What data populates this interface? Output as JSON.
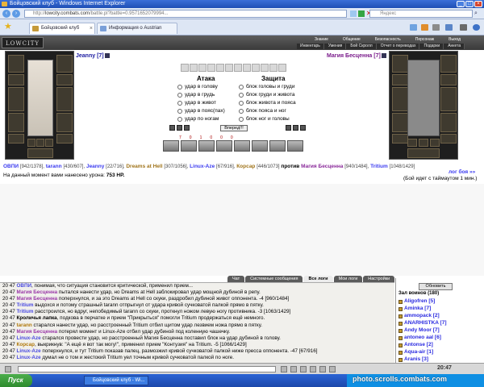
{
  "browser": {
    "title": "Бойцовский клуб - Windows Internet Explorer",
    "url_prefix": "http://",
    "url_domain": "lowcity.combats.com",
    "url_rest": "/battle.pl?battle=0.9571652079994...",
    "search_placeholder": "Яндекс",
    "tabs": [
      {
        "label": "Бойцовский клуб"
      },
      {
        "label": "Информация о Austrian"
      }
    ]
  },
  "game": {
    "logo": "LOWCITY",
    "menu_top": [
      "Знание",
      "Общение",
      "Безопасность",
      "Персонаж",
      "Выход"
    ],
    "menu_bottom": [
      "Инвентарь",
      "Умения",
      "Бой Скролл",
      "Отчет о переводах",
      "Подарки",
      "Анкета"
    ]
  },
  "combat": {
    "player_left": "Jeanny [7]",
    "player_right": "Магия Бесценна [7]",
    "attack_title": "Атака",
    "defense_title": "Защита",
    "attacks": [
      "удар в голову",
      "удар в грудь",
      "удар в живот",
      "удар в пояс(пах)",
      "удар по ногам"
    ],
    "defenses": [
      "блок головы и груди",
      "блок груди и живота",
      "блок живота и пояса",
      "блок пояса и ног",
      "блок ног и головы"
    ],
    "go_button": "Вперед!!!",
    "counters": [
      "7",
      "0",
      "1",
      "0",
      "0",
      "0"
    ]
  },
  "fighters": {
    "ally1": "ОВПИ",
    "ally1_hp": "[942/1378],",
    "ally2": "tarann",
    "ally2_hp": "[430/607],",
    "ally3": "Jeanny",
    "ally3_hp": "[22/716],",
    "ally4": "Dreams at Hell",
    "ally4_hp": "[307/1056],",
    "ally5": "Linux-Aze",
    "ally5_hp": "[67/916],",
    "ally6": "Корсар",
    "ally6_hp": "[446/1073]",
    "vs": "против",
    "enemy1": "Магия Бесценна",
    "enemy1_hp": "[940/1484],",
    "enemy2": "Tritium",
    "enemy2_hp": "[1048/1429]",
    "enemy3": "лог боя »»",
    "damage_label": "На данный момент вами нанесено урона:",
    "damage_value": "753 HP.",
    "timeout": "(Бой идет с таймаутом 1 мин.)"
  },
  "log_tabs": [
    "Чат",
    "Системные сообщения",
    "Все логи",
    "Мои логи",
    "Настройки"
  ],
  "log": [
    [
      "20 47",
      "ОВПИ",
      ", понимая, что ситуация становится критической, применил прием..."
    ],
    [
      "20 47",
      "Магия Бесценна",
      " пытался нанести удар, но Dreams at Hell заблокировал удар мощной дубиной в репу."
    ],
    [
      "20 47",
      "Магия Бесценна",
      " поперхнулся, и за это Dreams at Hell со скуки, раздробил дубиной живот оппонента. -4 [960/1484]"
    ],
    [
      "20 47",
      "Tritium",
      " выдохся и потому страшный tarann отпрыгнул от удара кривой сучковатой палкой прямо в пятку."
    ],
    [
      "20 47",
      "Tritium",
      " расстроился, но вдруг, непобедимый tarann со скуки, проткнул ножом левую ногу противника. -3 [1063/1429]"
    ],
    [
      "20 47",
      "Кроличья лапка",
      ", подкова в перчатке и прием \"Прикрыться\" помогли Tritium продержаться ещё немного."
    ],
    [
      "20 47",
      "tarann",
      " старался нанести удар, но расстроенный Tritium отбил щитом удар лезвием ножа прямо в пятку."
    ],
    [
      "20 47",
      "Магия Бесценна",
      " потерял момент и Linux-Aze отбил удар дубиной под коленную чашечку."
    ],
    [
      "20 47",
      "Linux-Aze",
      " старался провести удар, но расстроенный Магия Бесценна поставил блок на удар дубиной в голову."
    ],
    [
      "20 47",
      "Корсар",
      ", выкрикнув: \"А ещё я вот так могу!\", применил прием \"Контузия\" на Tritium. -5 [1066/1429]"
    ],
    [
      "20 47",
      "Linux-Aze",
      " поперхнулся, и тут Tritium показав палец, размозжил кривой сучковатой палкой ниже пресса оппонента. -47 [67/916]"
    ],
    [
      "20 47",
      "Linux-Aze",
      " думал не о том и жестокий Tritium уел точным кривой сучковатой палкой по ноге."
    ]
  ],
  "right_panel": {
    "refresh": "Обновить",
    "hall": "Зал воинов (180)",
    "roster": [
      "Aligofren [5]",
      "Aminka [7]",
      "ammopack [2]",
      "ANARHISTKA [7]",
      "Andy Moor [7]",
      "antoneo aal [6]",
      "Antonse [2]",
      "Aqua-air [1]",
      "Aranis [3]"
    ]
  },
  "chat": {
    "clock": "20:47"
  },
  "taskbar": {
    "start": "Пуск",
    "task": "Бойцовский клуб - Wi..."
  },
  "watermark": {
    "text": "photo.scrolls.combats.com",
    "sub": "20:47"
  }
}
